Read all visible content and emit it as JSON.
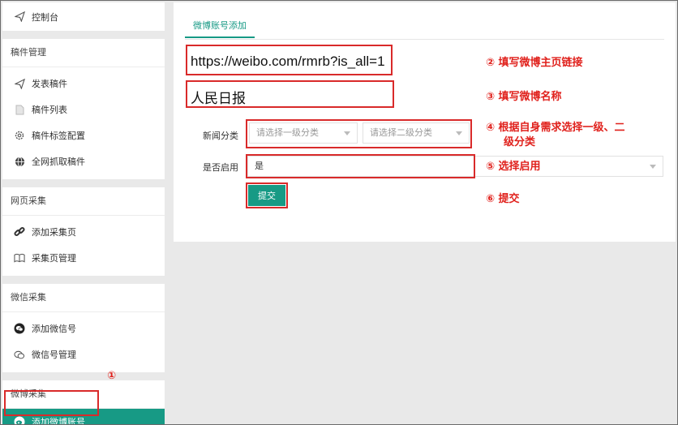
{
  "sidebar": {
    "console_label": "控制台",
    "sections": [
      {
        "title": "稿件管理",
        "items": [
          {
            "label": "发表稿件",
            "icon": "send-icon"
          },
          {
            "label": "稿件列表",
            "icon": "document-icon"
          },
          {
            "label": "稿件标签配置",
            "icon": "gear-icon"
          },
          {
            "label": "全网抓取稿件",
            "icon": "globe-icon"
          }
        ]
      },
      {
        "title": "网页采集",
        "items": [
          {
            "label": "添加采集页",
            "icon": "link-icon"
          },
          {
            "label": "采集页管理",
            "icon": "book-icon"
          }
        ]
      },
      {
        "title": "微信采集",
        "items": [
          {
            "label": "添加微信号",
            "icon": "wechat-icon"
          },
          {
            "label": "微信号管理",
            "icon": "wechat-outline-icon"
          }
        ]
      },
      {
        "title": "微博采集",
        "items": [
          {
            "label": "添加微博账号",
            "icon": "weibo-icon",
            "active": true
          }
        ]
      }
    ]
  },
  "main": {
    "tab_label": "微博账号添加",
    "url_value": "https://weibo.com/rmrb?is_all=1",
    "name_value": "人民日报",
    "category_label": "新闻分类",
    "category1_placeholder": "请选择一级分类",
    "category2_placeholder": "请选择二级分类",
    "enable_label": "是否启用",
    "enable_value": "是",
    "submit_label": "提交"
  },
  "annotations": {
    "n1": "①",
    "n2": "② 填写微博主页链接",
    "n3": "③ 填写微博名称",
    "n4_line1": "④ 根据自身需求选择一级、二",
    "n4_line2": "级分类",
    "n5": "⑤ 选择启用",
    "n6": "⑥ 提交"
  },
  "colors": {
    "accent": "#179a85",
    "highlight": "#d92a2a",
    "annotation": "#e0211c"
  }
}
